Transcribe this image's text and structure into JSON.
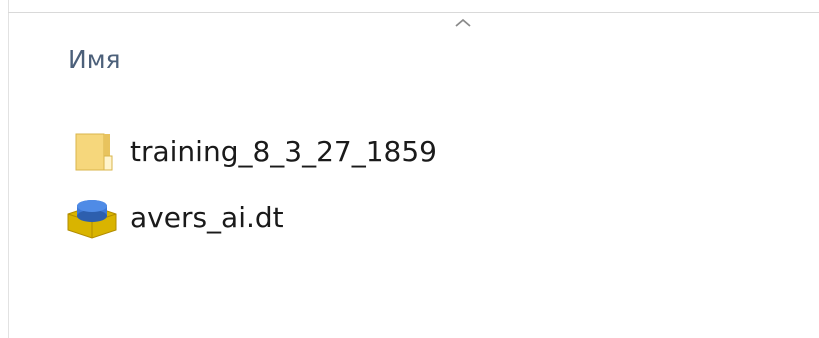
{
  "header": {
    "column_name": "Имя",
    "sort_icon": "chevron-up-icon"
  },
  "files": [
    {
      "name": "training_8_3_27_1859",
      "icon": "folder-icon"
    },
    {
      "name": "avers_ai.dt",
      "icon": "database-file-icon"
    }
  ]
}
